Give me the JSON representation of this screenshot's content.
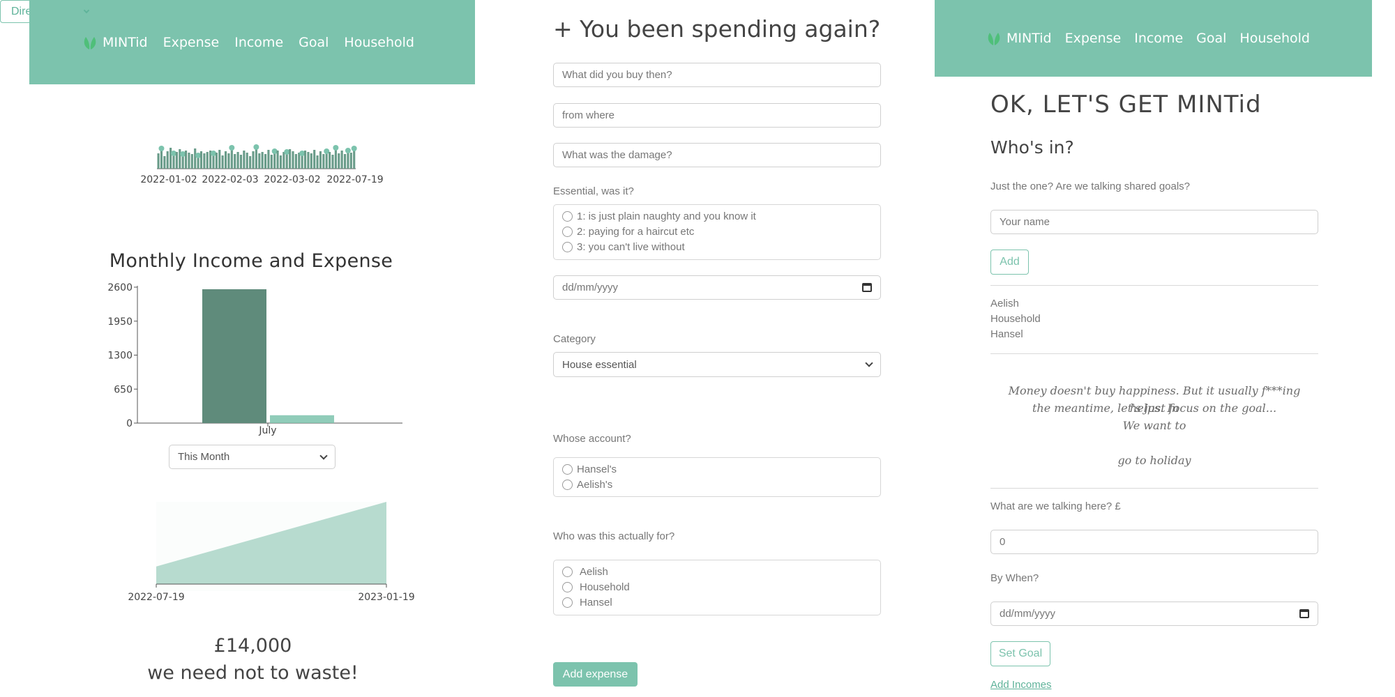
{
  "nav": {
    "brand": "MINTid",
    "links": [
      "Expense",
      "Income",
      "Goal",
      "Household"
    ]
  },
  "dashboard": {
    "timeline_ticks": [
      "2022-01-02",
      "2022-02-03",
      "2022-03-02",
      "2022-07-19"
    ],
    "period_select": "This Month",
    "goal_amount": "£14,000",
    "goal_caption": "we need not to waste!"
  },
  "expense_form": {
    "heading": "+ You been spending again?",
    "item_placeholder": "What did you buy then?",
    "where_placeholder": "from where",
    "amount_placeholder": "What was the damage?",
    "essential_label": "Essential, was it?",
    "essential_options": [
      "1: is just plain naughty and you know it",
      "2: paying for a haircut etc",
      "3: you can't live without"
    ],
    "date_placeholder": "dd/mm/yyyy",
    "category_label": "Category",
    "category_value": "House essential",
    "payment_value": "Direct Debit",
    "account_label": "Whose account?",
    "account_options": [
      "Hansel's",
      "Aelish's"
    ],
    "for_label": "Who was this actually for?",
    "for_options": [
      "Aelish",
      "Household",
      "Hansel"
    ],
    "submit_label": "Add expense"
  },
  "goal_panel": {
    "heading": "OK, LET'S GET MINTid",
    "who_heading": "Who's in?",
    "who_prompt": "Just the one? Are we talking shared goals?",
    "name_placeholder": "Your name",
    "add_label": "Add",
    "members": [
      "Aelish",
      "Household",
      "Hansel"
    ],
    "quote_line1": "Money doesn't buy happiness. But it usually f***ing helps. In",
    "quote_line2": "the meantime, let's just focus on the goal...",
    "quote_line3": "We want to",
    "goal_text": "go to holiday",
    "amount_label": "What are we talking here? £",
    "amount_value": "0",
    "when_label": "By When?",
    "date_placeholder": "dd/mm/yyyy",
    "set_goal_label": "Set Goal",
    "add_incomes_link": "Add Incomes"
  },
  "colors": {
    "mint": "#7cc3ad",
    "dark_bar": "#5f8b7b",
    "light_area": "#b7dbcf"
  },
  "chart_data": [
    {
      "type": "bar",
      "title": "Monthly Income and Expense",
      "categories": [
        "July"
      ],
      "series": [
        {
          "values": [
            2560
          ]
        },
        {
          "values": [
            150
          ]
        }
      ],
      "yticks": [
        0,
        650,
        1300,
        1950,
        2600
      ],
      "ylim": [
        0,
        2600
      ]
    },
    {
      "type": "area",
      "x": [
        "2022-07-19",
        "2023-01-19"
      ],
      "y": [
        3000,
        14000
      ],
      "xticks": [
        "2022-07-19",
        "2023-01-19"
      ]
    }
  ]
}
